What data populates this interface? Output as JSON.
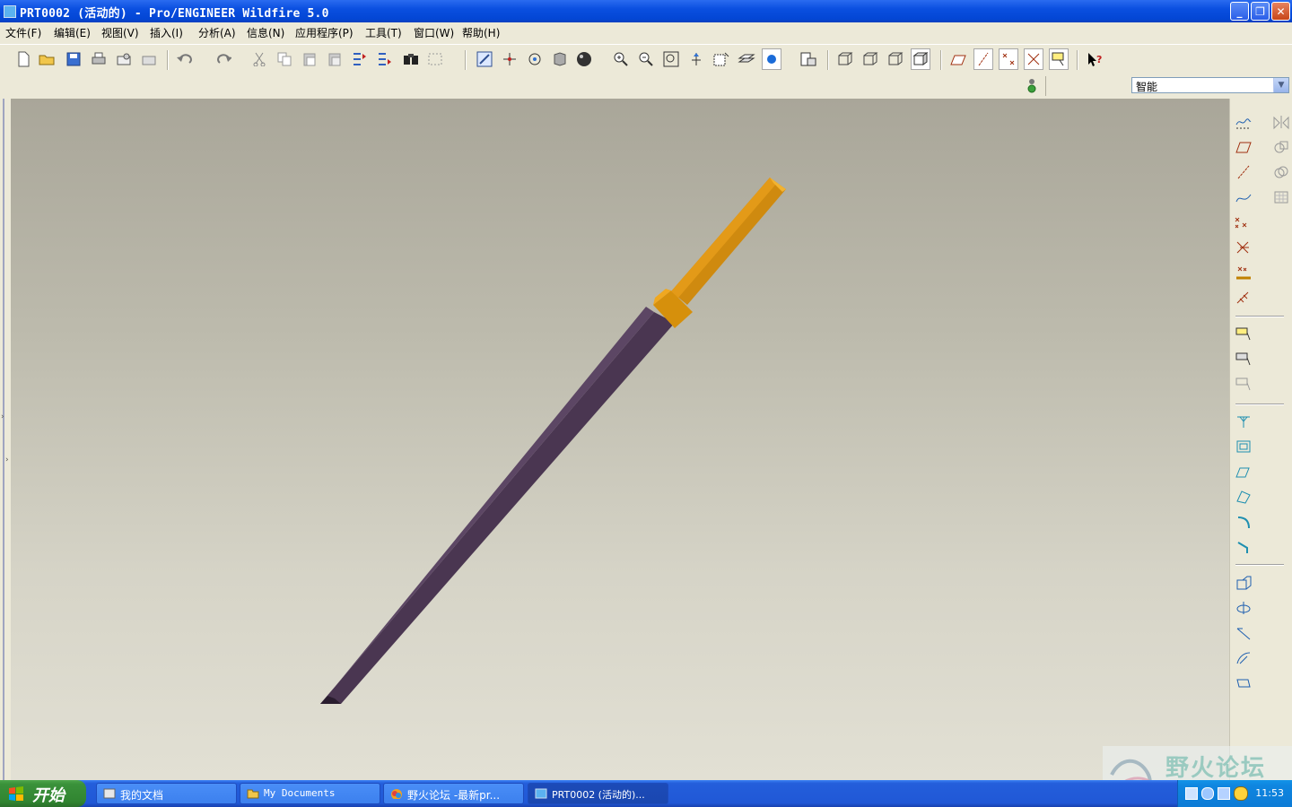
{
  "window": {
    "title": "PRT0002 (活动的) - Pro/ENGINEER Wildfire 5.0",
    "controls": [
      "minimize",
      "restore",
      "close"
    ]
  },
  "menubar": {
    "items": [
      "文件(F)",
      "编辑(E)",
      "视图(V)",
      "插入(I)",
      "分析(A)",
      "信息(N)",
      "应用程序(P)",
      "工具(T)",
      "窗口(W)",
      "帮助(H)"
    ]
  },
  "toolbar": {
    "icons": [
      "new-icon",
      "open-icon",
      "save-icon",
      "print-icon",
      "email-icon",
      "email-link-icon",
      "undo-icon",
      "redo-icon",
      "cut-icon",
      "copy-icon",
      "paste-icon",
      "paste-special-icon",
      "regenerate-icon",
      "regenerate-manager-icon",
      "find-icon",
      "select-box-icon",
      "repaint-icon",
      "spin-center-icon",
      "orient-mode-icon",
      "saved-views-icon",
      "appearance-icon",
      "zoom-in-icon",
      "zoom-out-icon",
      "refit-icon",
      "reorient-icon",
      "view-manager-icon",
      "layers-icon",
      "display-style-icon",
      "model-tree-icon",
      "wireframe-icon",
      "hidden-line-icon",
      "no-hidden-icon",
      "shading-icon",
      "datum-planes-icon",
      "datum-axes-icon",
      "datum-points-icon",
      "coordinate-systems-icon",
      "annotation-icon",
      "context-help-icon"
    ]
  },
  "filter": {
    "selected": "智能"
  },
  "model": {
    "shaft_color": "#4a3651",
    "handle_color": "#d08a10",
    "collar_color": "#e0950c"
  },
  "taskbar": {
    "start_label": "开始",
    "tasks": [
      {
        "label": "我的文档",
        "active": false
      },
      {
        "label": "My Documents",
        "active": false
      },
      {
        "label": "野火论坛 -最新pr...",
        "active": false
      },
      {
        "label": "PRT0002 (活动的)...",
        "active": true
      }
    ],
    "clock": "11:53"
  },
  "watermark": {
    "text": "野火论坛"
  }
}
